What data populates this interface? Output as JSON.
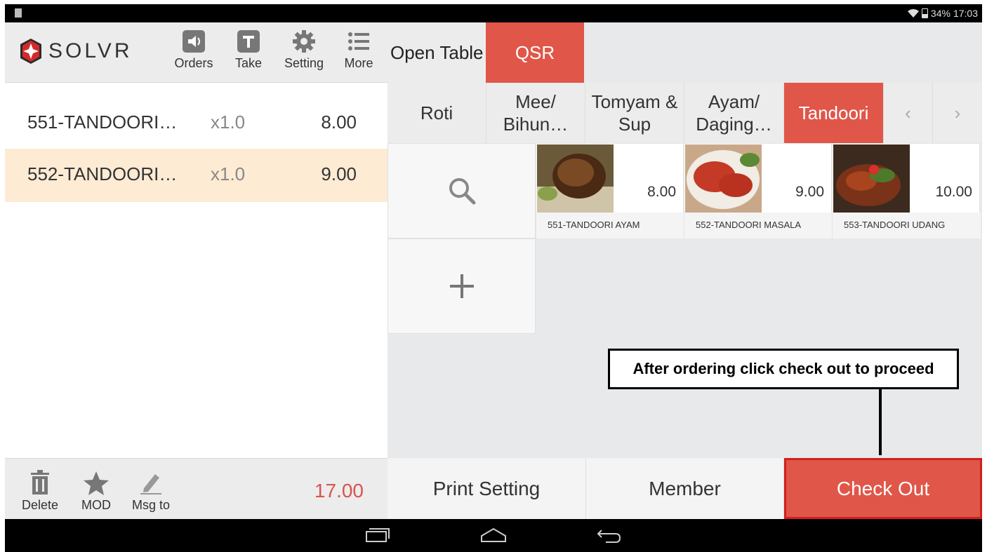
{
  "status_bar": {
    "battery": "34%",
    "time": "17:03"
  },
  "header": {
    "logo_text": "SOLVR",
    "toolbar": [
      {
        "label": "Orders",
        "icon": "speaker-icon"
      },
      {
        "label": "Take",
        "icon": "t-box-icon"
      },
      {
        "label": "Setting",
        "icon": "gear-icon"
      },
      {
        "label": "More",
        "icon": "list-icon"
      }
    ]
  },
  "tabs": {
    "open_table": "Open Table",
    "qsr": "QSR"
  },
  "categories": [
    "Roti",
    "Mee/\nBihun…",
    "Tomyam &\nSup",
    "Ayam/\nDaging…",
    "Tandoori"
  ],
  "active_category": "Tandoori",
  "orders": [
    {
      "name": "551-TANDOORI…",
      "qty": "x1.0",
      "price": "8.00"
    },
    {
      "name": "552-TANDOORI…",
      "qty": "x1.0",
      "price": "9.00"
    }
  ],
  "bottom_left": {
    "delete": "Delete",
    "mod": "MOD",
    "msg": "Msg to",
    "total": "17.00"
  },
  "products": [
    {
      "name": "551-TANDOORI AYAM",
      "price": "8.00"
    },
    {
      "name": "552-TANDOORI MASALA",
      "price": "9.00"
    },
    {
      "name": "553-TANDOORI UDANG",
      "price": "10.00"
    }
  ],
  "bottom_right": {
    "print": "Print Setting",
    "member": "Member",
    "checkout": "Check Out"
  },
  "callout": "After ordering click check out to proceed",
  "colors": {
    "accent": "#e05649",
    "selected_row": "#fdebd3",
    "total": "#d9534f"
  }
}
